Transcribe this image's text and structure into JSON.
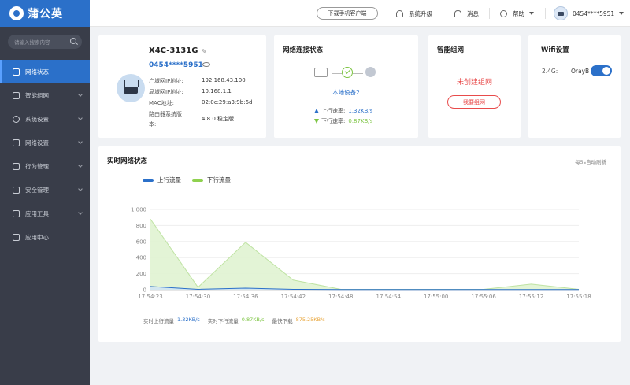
{
  "app": {
    "brand": "蒲公英"
  },
  "sidebar": {
    "search_placeholder": "请输入搜索内容",
    "items": [
      {
        "label": "网络状态",
        "active": true
      },
      {
        "label": "智能组网"
      },
      {
        "label": "系统设置"
      },
      {
        "label": "网络设置"
      },
      {
        "label": "行为管理"
      },
      {
        "label": "安全管理"
      },
      {
        "label": "应用工具"
      },
      {
        "label": "应用中心"
      }
    ]
  },
  "header": {
    "download_label": "下载手机客户端",
    "upgrade_label": "系统升级",
    "messages_label": "消息",
    "help_label": "帮助",
    "account_label": "0454****5951"
  },
  "device": {
    "name": "X4C-3131G",
    "id": "0454****5951",
    "wan_ip_label": "广域网IP地址:",
    "wan_ip": "192.168.43.100",
    "lan_ip_label": "局域网IP地址:",
    "lan_ip": "10.168.1.1",
    "mac_label": "MAC地址:",
    "mac": "02:0c:29:a3:9b:6d",
    "fw_label_1": "路由器系统版",
    "fw_label_2": "本:",
    "fw_version": "4.8.0 稳定版"
  },
  "net_status": {
    "title": "网络连接状态",
    "device_label": "本地设备2",
    "up_label": "上行速率:",
    "up_value": "1.32KB/s",
    "down_label": "下行速率:",
    "down_value": "0.87KB/s"
  },
  "mesh": {
    "title": "智能组网",
    "status": "未创建组网",
    "button": "我要组网"
  },
  "wifi": {
    "title": "Wifi设置",
    "band": "2.4G:",
    "ssid": "OrayB",
    "enabled": true
  },
  "realtime": {
    "title": "实时网络状态",
    "refresh_hint": "每5s自动刷新",
    "footer_up_label": "实时上行流量",
    "footer_up_value": "1.32KB/s",
    "footer_down_label": "实时下行流量",
    "footer_down_value": "0.87KB/s",
    "footer_max_label": "最快下载",
    "footer_max_value": "875.25KB/s"
  },
  "colors": {
    "accent": "#2b70c9",
    "upload": "#2b70c9",
    "download": "#8fd14f",
    "download_area": "#dff2cf",
    "danger": "#e84b4b",
    "max_value": "#e8a53a"
  },
  "chart_data": {
    "type": "area",
    "categories": [
      "17:54:23",
      "17:54:30",
      "17:54:36",
      "17:54:42",
      "17:54:48",
      "17:54:54",
      "17:55:00",
      "17:55:06",
      "17:55:12",
      "17:55:18"
    ],
    "ylim": [
      0,
      1000
    ],
    "yticks": [
      0,
      200,
      400,
      600,
      800,
      1000
    ],
    "ytick_labels": [
      "0",
      "200",
      "400",
      "600",
      "800",
      "1,000"
    ],
    "grid": true,
    "legend": "top-left",
    "series": [
      {
        "name": "上行流量",
        "values": [
          40,
          5,
          20,
          5,
          2,
          2,
          2,
          2,
          3,
          2
        ]
      },
      {
        "name": "下行流量",
        "values": [
          880,
          30,
          590,
          120,
          5,
          5,
          5,
          5,
          70,
          5
        ]
      }
    ]
  }
}
